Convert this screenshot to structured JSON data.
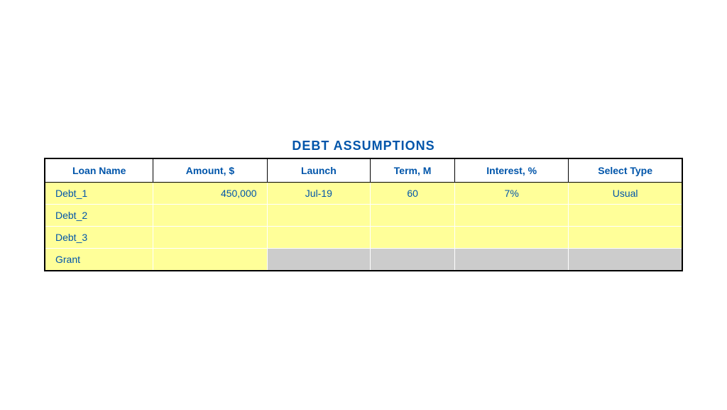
{
  "title": "DEBT ASSUMPTIONS",
  "columns": [
    {
      "key": "loan_name",
      "label": "Loan Name",
      "class": "col-loan"
    },
    {
      "key": "amount",
      "label": "Amount, $",
      "class": "col-amount"
    },
    {
      "key": "launch",
      "label": "Launch",
      "class": "col-launch"
    },
    {
      "key": "term",
      "label": "Term, M",
      "class": "col-term"
    },
    {
      "key": "interest",
      "label": "Interest, %",
      "class": "col-interest"
    },
    {
      "key": "select_type",
      "label": "Select Type",
      "class": "col-type"
    }
  ],
  "rows": [
    {
      "type": "normal",
      "cells": {
        "loan_name": "Debt_1",
        "amount": "450,000",
        "launch": "Jul-19",
        "term": "60",
        "interest": "7%",
        "select_type": "Usual"
      }
    },
    {
      "type": "normal",
      "cells": {
        "loan_name": "Debt_2",
        "amount": "",
        "launch": "",
        "term": "",
        "interest": "",
        "select_type": ""
      }
    },
    {
      "type": "normal",
      "cells": {
        "loan_name": "Debt_3",
        "amount": "",
        "launch": "",
        "term": "",
        "interest": "",
        "select_type": ""
      }
    },
    {
      "type": "grant",
      "cells": {
        "loan_name": "Grant",
        "amount": "",
        "launch": "",
        "term": "",
        "interest": "",
        "select_type": ""
      }
    }
  ]
}
